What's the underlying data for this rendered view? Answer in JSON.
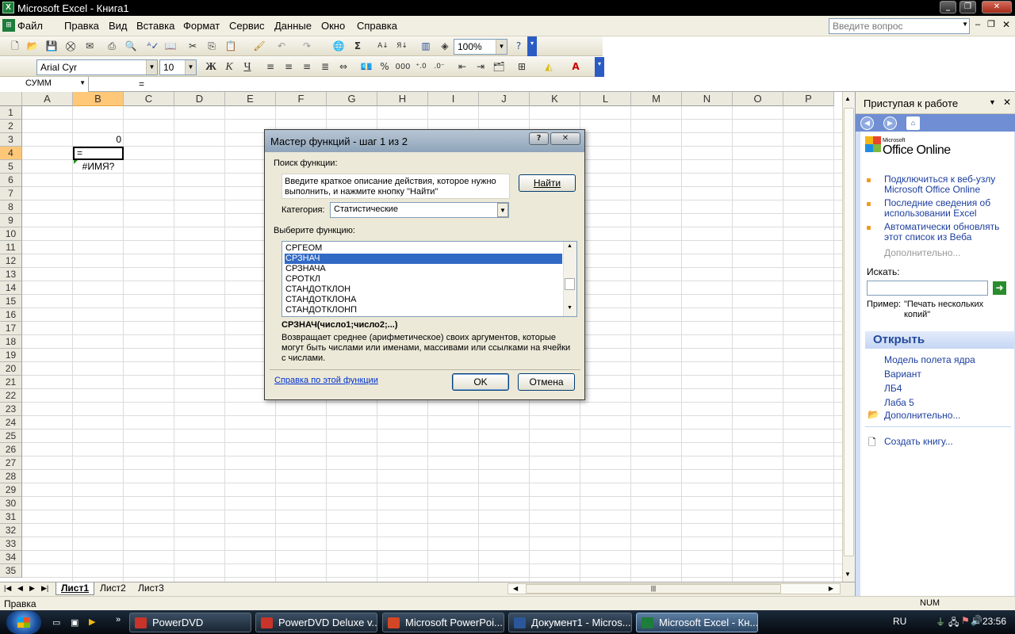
{
  "window": {
    "title": "Microsoft Excel - Книга1",
    "app_icon_letter": "X"
  },
  "menu": [
    "Файл",
    "Правка",
    "Вид",
    "Вставка",
    "Формат",
    "Сервис",
    "Данные",
    "Окно",
    "Справка"
  ],
  "help_box": {
    "placeholder": "Введите вопрос"
  },
  "toolbar": {
    "zoom": "100%",
    "font_name": "Arial Cyr",
    "font_size": "10",
    "bold": "Ж",
    "italic": "К",
    "underline": "Ч",
    "percent": "%",
    "thousands": "000"
  },
  "formula_bar": {
    "name_box": "СУММ",
    "content": "="
  },
  "grid": {
    "columns": [
      "A",
      "B",
      "C",
      "D",
      "E",
      "F",
      "G",
      "H",
      "I",
      "J",
      "K",
      "L",
      "M",
      "N",
      "O",
      "P"
    ],
    "rows": [
      "1",
      "2",
      "3",
      "4",
      "5",
      "6",
      "7",
      "8",
      "9",
      "10",
      "11",
      "12",
      "13",
      "14",
      "15",
      "16",
      "17",
      "18",
      "19",
      "20",
      "21",
      "22",
      "23",
      "24",
      "25",
      "26",
      "27",
      "28",
      "29",
      "30",
      "31",
      "32",
      "33",
      "34",
      "35"
    ],
    "cells": {
      "B3": "0",
      "B4": "=",
      "B5": "#ИМЯ?"
    }
  },
  "sheets": [
    "Лист1",
    "Лист2",
    "Лист3"
  ],
  "status": {
    "left": "Правка",
    "num": "NUM"
  },
  "dialog": {
    "title": "Мастер функций - шаг 1 из 2",
    "search_label": "Поиск функции:",
    "search_text": "Введите краткое описание действия, которое нужно выполнить, и нажмите кнопку \"Найти\"",
    "find_button": "Найти",
    "category_label": "Категория:",
    "category_value": "Статистические",
    "choose_label": "Выберите функцию:",
    "functions": [
      "СРГЕОМ",
      "СРЗНАЧ",
      "СРЗНАЧА",
      "СРОТКЛ",
      "СТАНДОТКЛОН",
      "СТАНДОТКЛОНА",
      "СТАНДОТКЛОНП"
    ],
    "selected_function": "СРЗНАЧ",
    "signature": "СРЗНАЧ(число1;число2;...)",
    "description": "Возвращает среднее (арифметическое) своих аргументов, которые могут быть числами или именами, массивами или ссылками на ячейки с числами.",
    "help_link": "Справка по этой функции",
    "ok": "OK",
    "cancel": "Отмена"
  },
  "task_pane": {
    "title": "Приступая к работе",
    "logo_small": "Microsoft",
    "logo": "Office Online",
    "links": [
      "Подключиться к веб-узлу Microsoft Office Online",
      "Последние сведения об использовании Excel",
      "Автоматически обновлять этот список из Веба"
    ],
    "more": "Дополнительно...",
    "search_label": "Искать:",
    "example_label": "Пример:",
    "example_text": "\"Печать нескольких копий\"",
    "open_header": "Открыть",
    "recent_files": [
      "Модель полета ядра",
      "Вариант",
      "ЛБ4",
      "Лаба 5"
    ],
    "open_more": "Дополнительно...",
    "create": "Создать книгу..."
  },
  "taskbar": {
    "items": [
      "PowerDVD",
      "PowerDVD Deluxe v...",
      "Microsoft PowerPoi...",
      "Документ1 - Micros...",
      "Microsoft Excel - Кн..."
    ],
    "language": "RU",
    "clock": "23:56"
  },
  "colors": {
    "selection": "#316ac5",
    "pane_bg": "#d4e0f8",
    "link": "#1c3e9f",
    "orange_bullet": "#f29a1d"
  }
}
